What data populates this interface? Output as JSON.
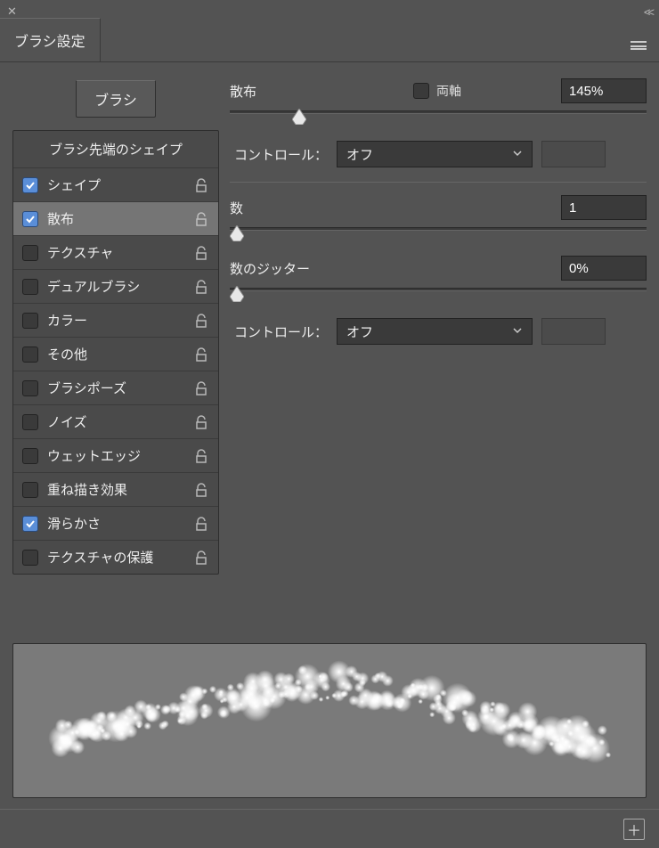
{
  "panel": {
    "title": "ブラシ設定",
    "brush_button": "ブラシ"
  },
  "sidebar": {
    "header": "ブラシ先端のシェイプ",
    "items": [
      {
        "label": "シェイプ",
        "checked": true,
        "locked": false
      },
      {
        "label": "散布",
        "checked": true,
        "locked": false,
        "selected": true
      },
      {
        "label": "テクスチャ",
        "checked": false,
        "locked": false
      },
      {
        "label": "デュアルブラシ",
        "checked": false,
        "locked": false
      },
      {
        "label": "カラー",
        "checked": false,
        "locked": false
      },
      {
        "label": "その他",
        "checked": false,
        "locked": false
      },
      {
        "label": "ブラシポーズ",
        "checked": false,
        "locked": false
      },
      {
        "label": "ノイズ",
        "checked": false,
        "locked": false
      },
      {
        "label": "ウェットエッジ",
        "checked": false,
        "locked": false
      },
      {
        "label": "重ね描き効果",
        "checked": false,
        "locked": false
      },
      {
        "label": "滑らかさ",
        "checked": true,
        "locked": false
      },
      {
        "label": "テクスチャの保護",
        "checked": false,
        "locked": false
      }
    ]
  },
  "settings": {
    "scatter": {
      "label": "散布",
      "both_axes_label": "両軸",
      "both_axes_checked": false,
      "value": "145%",
      "slider_pct": 15,
      "control_label": "コントロール：",
      "control_value": "オフ"
    },
    "count": {
      "label": "数",
      "value": "1",
      "slider_pct": 0
    },
    "count_jitter": {
      "label": "数のジッター",
      "value": "0%",
      "slider_pct": 0,
      "control_label": "コントロール：",
      "control_value": "オフ"
    }
  }
}
